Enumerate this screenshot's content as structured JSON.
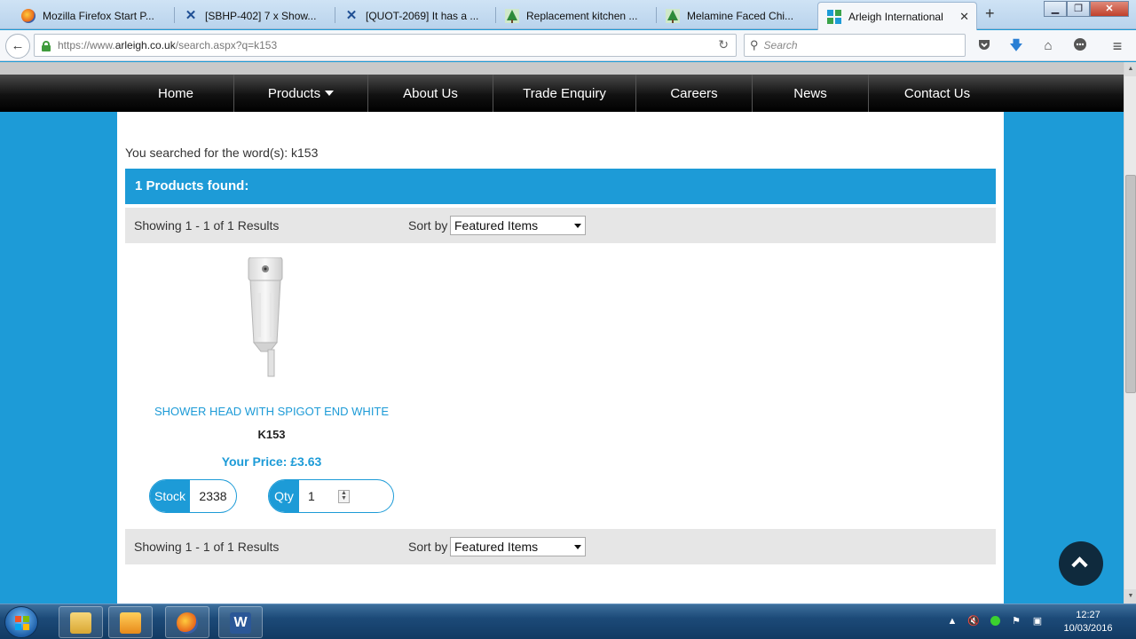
{
  "browser": {
    "tabs": [
      {
        "title": "Mozilla Firefox Start P...",
        "icon": "firefox-icon",
        "active": false
      },
      {
        "title": "[SBHP-402] 7 x Show...",
        "icon": "jira-icon",
        "active": false
      },
      {
        "title": "[QUOT-2069] It has a ...",
        "icon": "jira-icon",
        "active": false
      },
      {
        "title": "Replacement kitchen ...",
        "icon": "tree-icon",
        "active": false
      },
      {
        "title": "Melamine Faced Chi...",
        "icon": "tree-icon",
        "active": false
      },
      {
        "title": "Arleigh International",
        "icon": "arleigh-icon",
        "active": true
      }
    ],
    "url_prefix": "https://www.",
    "url_domain": "arleigh.co.uk",
    "url_path": "/search.aspx?q=k153",
    "search_placeholder": "Search",
    "new_tab_label": "+"
  },
  "site_nav": {
    "items": [
      {
        "label": "Home",
        "has_dropdown": false
      },
      {
        "label": "Products",
        "has_dropdown": true
      },
      {
        "label": "About Us",
        "has_dropdown": false
      },
      {
        "label": "Trade Enquiry",
        "has_dropdown": false
      },
      {
        "label": "Careers",
        "has_dropdown": false
      },
      {
        "label": "News",
        "has_dropdown": false
      },
      {
        "label": "Contact Us",
        "has_dropdown": false
      }
    ]
  },
  "search": {
    "searched_text": "You searched for the word(s): k153",
    "found_text": "1 Products found:",
    "showing_text": "Showing 1 - 1 of 1 Results",
    "sort_label": "Sort by",
    "sort_value": "Featured Items"
  },
  "product": {
    "name": "SHOWER HEAD WITH SPIGOT END WHITE",
    "code": "K153",
    "price": "Your Price: £3.63",
    "stock_label": "Stock",
    "stock_value": "2338",
    "qty_label": "Qty",
    "qty_value": "1"
  },
  "taskbar": {
    "time": "12:27",
    "date": "10/03/2016",
    "apps": [
      "explorer-icon",
      "outlook-icon",
      "firefox-icon",
      "word-icon"
    ]
  },
  "colors": {
    "brand_blue": "#1d9bd7",
    "nav_black": "#000000",
    "to_top_button": "#0f2a3d"
  }
}
